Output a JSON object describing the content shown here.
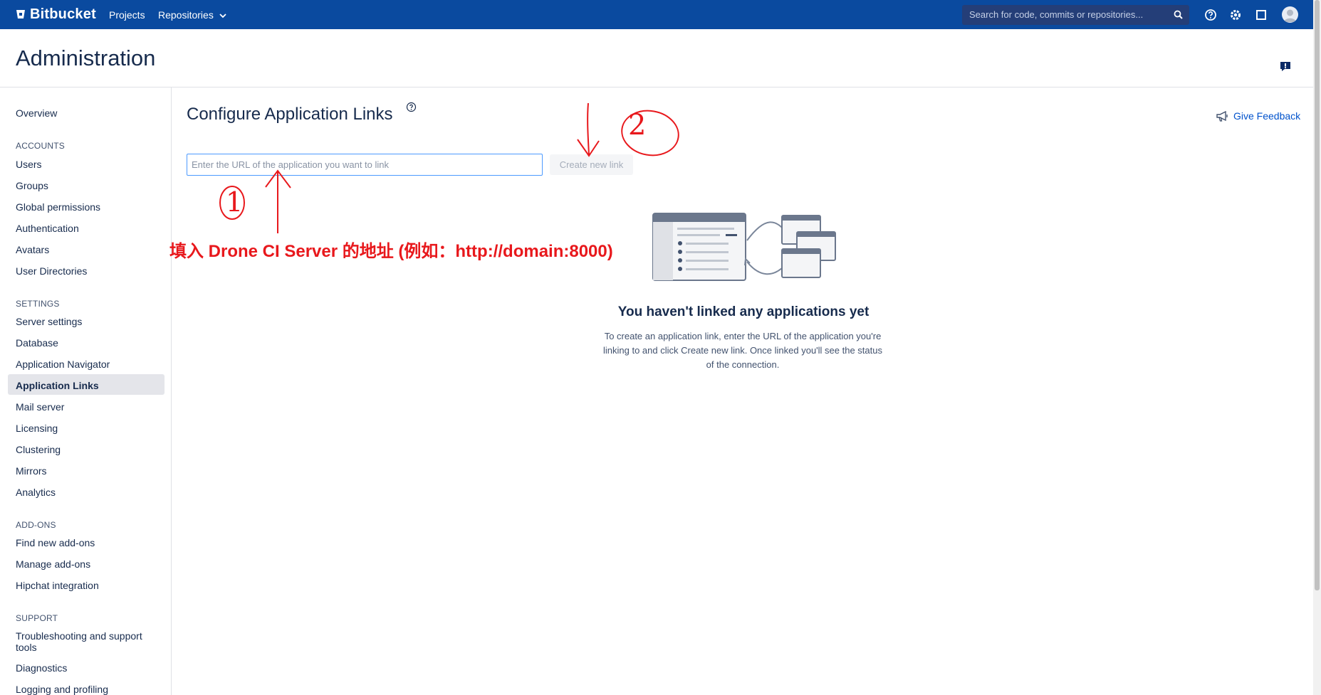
{
  "topbar": {
    "brand": "Bitbucket",
    "nav": {
      "projects": "Projects",
      "repositories": "Repositories"
    },
    "search_placeholder": "Search for code, commits or repositories...",
    "icons": [
      "help-icon",
      "gear-icon",
      "window-icon",
      "avatar"
    ]
  },
  "page": {
    "title": "Administration"
  },
  "sidebar": {
    "overview": "Overview",
    "accounts": {
      "heading": "ACCOUNTS",
      "items": [
        "Users",
        "Groups",
        "Global permissions",
        "Authentication",
        "Avatars",
        "User Directories"
      ]
    },
    "settings": {
      "heading": "SETTINGS",
      "items": [
        "Server settings",
        "Database",
        "Application Navigator",
        "Application Links",
        "Mail server",
        "Licensing",
        "Clustering",
        "Mirrors",
        "Analytics"
      ]
    },
    "addons": {
      "heading": "ADD-ONS",
      "items": [
        "Find new add-ons",
        "Manage add-ons",
        "Hipchat integration"
      ]
    },
    "support": {
      "heading": "SUPPORT",
      "items": [
        "Troubleshooting and support tools",
        "Diagnostics",
        "Logging and profiling"
      ]
    }
  },
  "main": {
    "title": "Configure Application Links",
    "input_placeholder": "Enter the URL of the application you want to link",
    "create_button": "Create new link",
    "give_feedback": "Give Feedback",
    "empty_title": "You haven't linked any applications yet",
    "empty_desc": "To create an application link, enter the URL of the application you're linking to and click Create new link. Once linked you'll see the status of the connection."
  },
  "annotations": {
    "step1": "1",
    "step2": "2",
    "instruction": "填入 Drone CI Server 的地址 (例如：http://domain:8000)"
  },
  "colors": {
    "topbar": "#0a4a9f",
    "link": "#0052cc",
    "annotation": "#e8181c"
  }
}
